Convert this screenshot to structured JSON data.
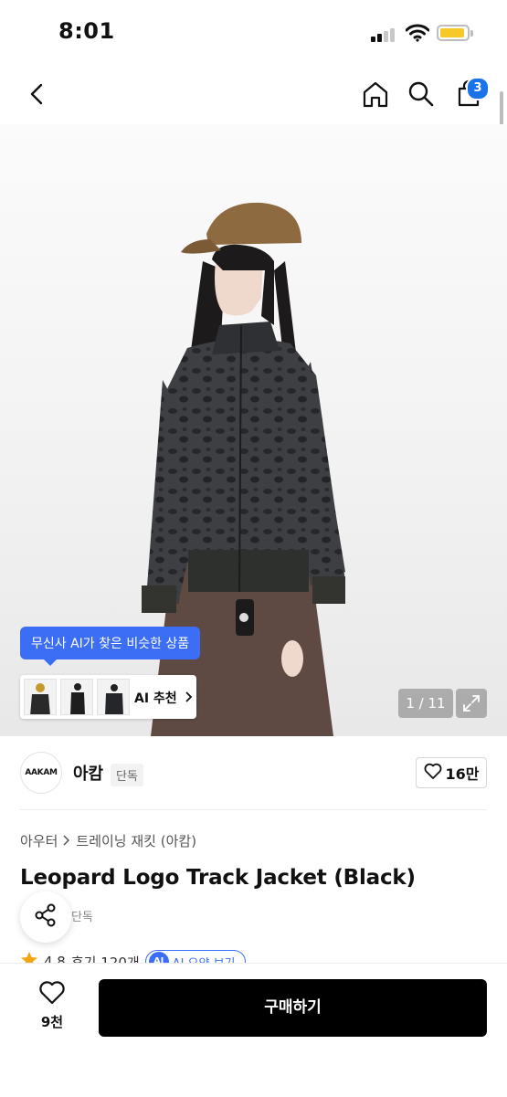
{
  "status_bar": {
    "time": "8:01"
  },
  "nav": {
    "cart_count": "3"
  },
  "hero": {
    "ai_tooltip": "무신사 AI가 찾은 비슷한 상품",
    "ai_recommend_label": "AI 추천",
    "image_counter": "1 / 11"
  },
  "brand": {
    "logo_text": "AAKAM",
    "name": "아캄",
    "exclusive_tag": "단독",
    "like_count": "16만"
  },
  "product": {
    "category_main": "아우터",
    "category_sub": "트레이닝 재킷 (아캄)",
    "title": "Leopard Logo Track Jacket (Black)",
    "tag": "단독",
    "rating": "4.8",
    "review_count": "후기 120개",
    "ai_summary_label": "AI 요약 보기",
    "ai_badge": "AI"
  },
  "bottom_bar": {
    "wish_count": "9천",
    "buy_label": "구매하기"
  },
  "colors": {
    "accent_blue": "#3b6ef5",
    "badge_blue": "#1a73e8",
    "buy_button": "#000000",
    "battery": "#f6c928"
  }
}
